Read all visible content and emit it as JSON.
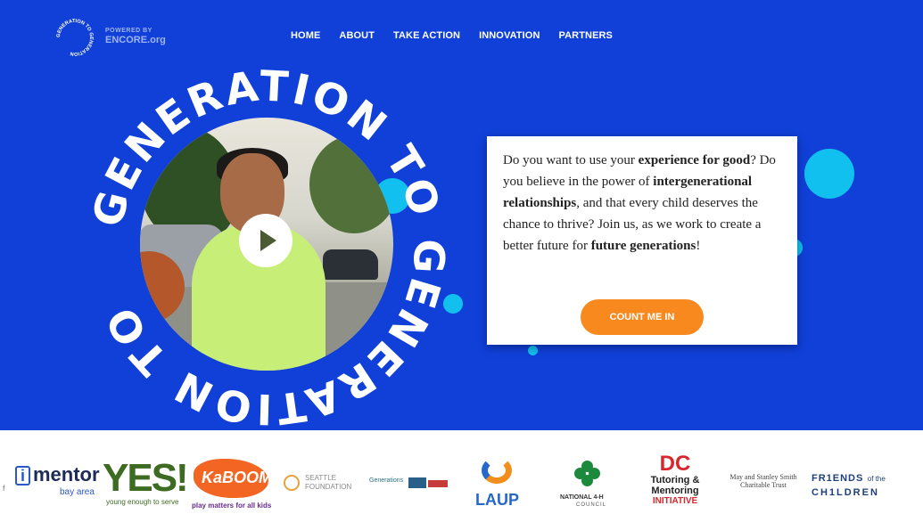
{
  "header": {
    "logo_text": "GENERATION TO GENERATION",
    "powered_small": "POWERED BY",
    "powered_brand": "ENCORE.org",
    "nav": [
      "HOME",
      "ABOUT",
      "TAKE ACTION",
      "INNOVATION",
      "PARTNERS"
    ]
  },
  "hero": {
    "ring_text": "GENERATION TO GENERATION TO",
    "card": {
      "t1": "Do you want to use your ",
      "b1": "experience for good",
      "t2": "? Do you believe in the power of ",
      "b2": "intergenerational relationships",
      "t3": ", and that every child deserves the chance to thrive? Join us, as we work to create a better future for ",
      "b3": "future generations",
      "t4": "!"
    },
    "cta": "COUNT ME IN"
  },
  "partners": {
    "imentor_main": "mentor",
    "imentor_i": "i",
    "imentor_sub": "bay area",
    "yes_main": "YES!",
    "yes_sub": "young enough to serve",
    "kaboom_main": "KaBOOM!",
    "kaboom_sub": "play matters for all kids",
    "seattle": "SEATTLE",
    "seattle2": "FOUNDATION",
    "generations": "Generations",
    "laup": "LAUP",
    "fourh_1": "NATIONAL 4-H",
    "fourh_2": "COUNCIL",
    "dc_main": "DC",
    "dc_2": "Tutoring &",
    "dc_3": "Mentoring",
    "dc_4": "INITIATIVE",
    "smith_1": "May and Stanley Smith",
    "smith_2": "Charitable Trust",
    "friends_1": "FR1ENDS",
    "friends_of": "of the",
    "friends_2": "CH1LDREN",
    "edge_letter": "f"
  },
  "colors": {
    "hero_blue": "#1040d8",
    "accent_orange": "#f7891f",
    "dot_cyan": "#12c0f0"
  }
}
